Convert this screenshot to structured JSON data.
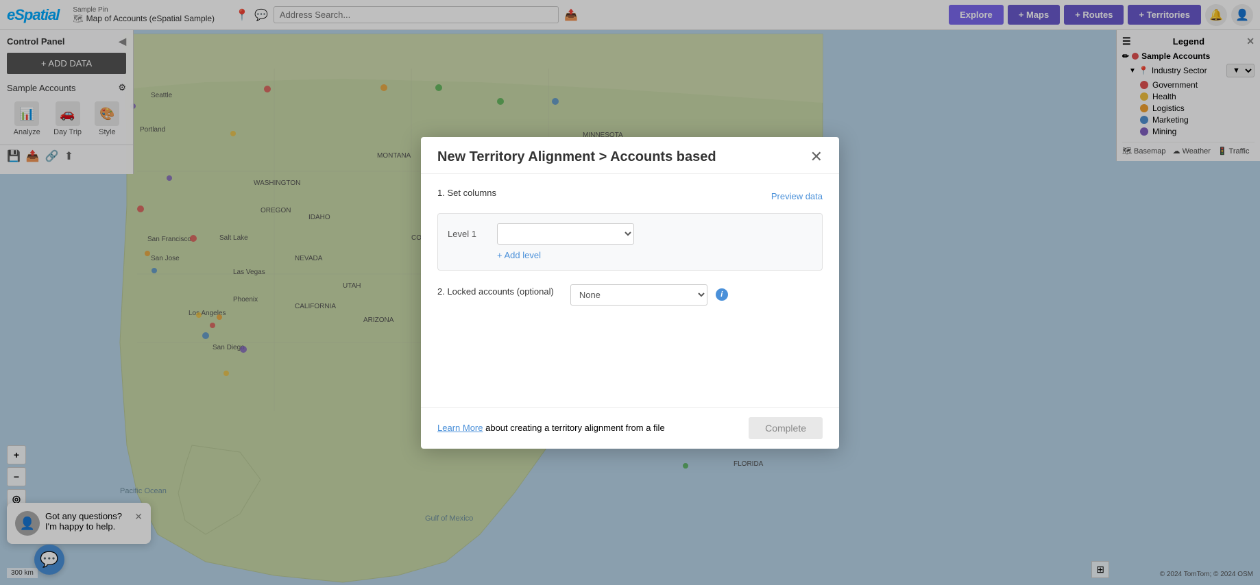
{
  "app": {
    "logo": "eSpatial",
    "breadcrumb": {
      "pin_label": "Sample Pin",
      "map_name": "Map of Accounts (eSpatial Sample)"
    }
  },
  "topbar": {
    "search_placeholder": "Address Search...",
    "btn_explore": "Explore",
    "btn_maps": "+ Maps",
    "btn_routes": "+ Routes",
    "btn_territories": "+ Territories"
  },
  "left_panel": {
    "title": "Control Panel",
    "add_data_label": "+ ADD DATA",
    "sample_accounts_label": "Sample Accounts",
    "tools": [
      {
        "id": "analyze",
        "label": "Analyze",
        "icon": "📊"
      },
      {
        "id": "day-trip",
        "label": "Day Trip",
        "icon": "🚗"
      },
      {
        "id": "style",
        "label": "Style",
        "icon": "🎨"
      }
    ]
  },
  "right_panel": {
    "title": "Legend",
    "layer_label": "Sample Accounts",
    "sector_label": "Industry Sector",
    "items": [
      {
        "id": "government",
        "label": "Government",
        "color": "#e05252"
      },
      {
        "id": "health",
        "label": "Health",
        "color": "#f0c040"
      },
      {
        "id": "logistics",
        "label": "Logistics",
        "color": "#f0a030"
      },
      {
        "id": "marketing",
        "label": "Marketing",
        "color": "#5090d0"
      },
      {
        "id": "mining",
        "label": "Mining",
        "color": "#8060c0"
      }
    ],
    "basemap": "Basemap",
    "weather": "Weather",
    "traffic": "Traffic"
  },
  "modal": {
    "title": "New Territory Alignment > Accounts based",
    "section1_label": "1.  Set columns",
    "preview_data_label": "Preview data",
    "level1_label": "Level 1",
    "level1_placeholder": "",
    "add_level_label": "+ Add level",
    "section2_label": "2.  Locked accounts (optional)",
    "locked_accounts_default": "None",
    "learn_more_text": "Learn More",
    "learn_more_suffix": " about creating a territory alignment from a file",
    "complete_label": "Complete"
  },
  "chat": {
    "message": "Got any questions? I'm happy to help."
  },
  "copyright": "© 2024 TomTom; © 2024 OSM",
  "scale_label": "300 km"
}
